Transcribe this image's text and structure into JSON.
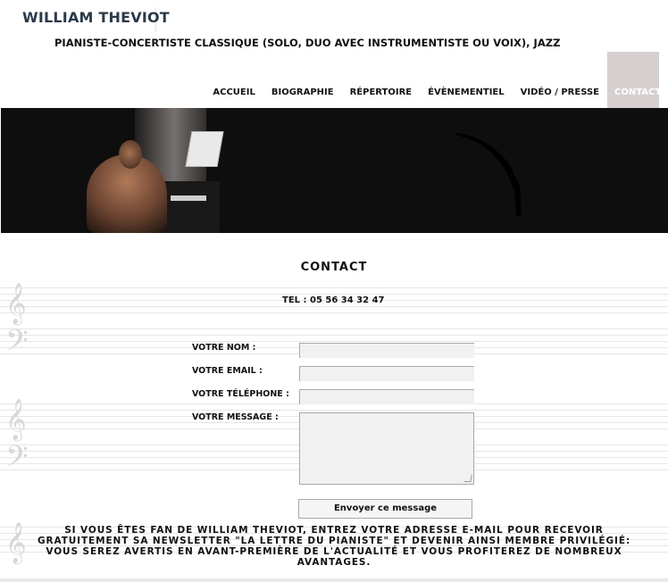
{
  "brand": {
    "name": "WILLIAM THEVIOT",
    "tagline": "PIANISTE-CONCERTISTE CLASSIQUE (SOLO, DUO AVEC INSTRUMENTISTE OU VOIX), JAZZ"
  },
  "nav": {
    "items": [
      {
        "label": "ACCUEIL"
      },
      {
        "label": "BIOGRAPHIE"
      },
      {
        "label": "RÉPERTOIRE"
      },
      {
        "label": "ÉVÈNEMENTIEL"
      },
      {
        "label": "VIDÉO / PRESSE"
      },
      {
        "label": "CONTACT",
        "active": true
      }
    ]
  },
  "contact": {
    "title": "CONTACT",
    "phone": "TEL : 05 56 34 32 47",
    "form": {
      "name_label": "VOTRE NOM :",
      "email_label": "VOTRE EMAIL :",
      "phone_label": "VOTRE TÉLÉPHONE :",
      "message_label": "VOTRE MESSAGE :",
      "name_value": "",
      "email_value": "",
      "phone_value": "",
      "message_value": "",
      "submit_label": "Envoyer ce message"
    },
    "newsletter": "SI VOUS ÊTES FAN DE WILLIAM THEVIOT, ENTREZ VOTRE ADRESSE E-MAIL POUR RECEVOIR GRATUITEMENT SA NEWSLETTER \"LA LETTRE DU PIANISTE\" ET DEVENIR AINSI MEMBRE PRIVILÉGIÉ: VOUS SEREZ AVERTIS EN AVANT-PREMIÈRE DE L'ACTUALITÉ ET VOUS PROFITEREZ DE NOMBREUX AVANTAGES."
  },
  "colors": {
    "active_nav_bg": "#d6cfcf",
    "banner_bg": "#0f0e0e",
    "brand_text": "#2b3a4a"
  },
  "icons": {
    "clef": "treble-clef-icon",
    "bass": "bass-clef-icon"
  }
}
